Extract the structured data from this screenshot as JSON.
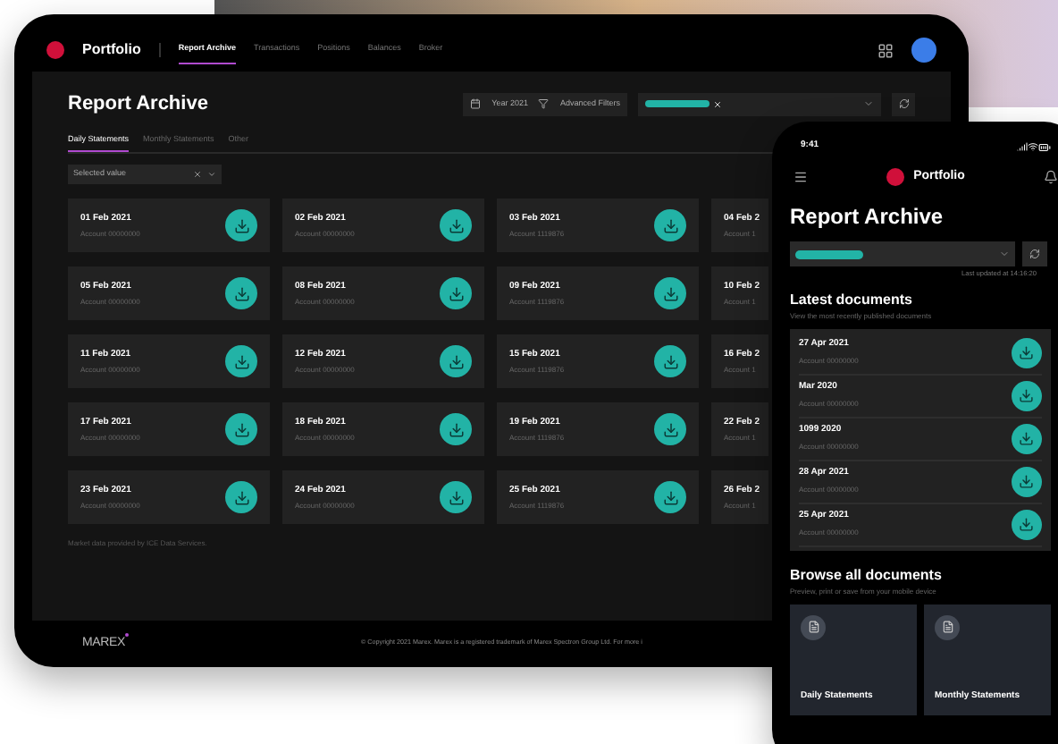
{
  "tablet": {
    "brand": "Portfolio",
    "nav": [
      {
        "label": "Report Archive",
        "selected": true
      },
      {
        "label": "Transactions",
        "selected": false
      },
      {
        "label": "Positions",
        "selected": false
      },
      {
        "label": "Balances",
        "selected": false
      },
      {
        "label": "Broker",
        "selected": false
      }
    ],
    "title": "Report Archive",
    "year_filter": "Year 2021",
    "advanced_filters": "Advanced Filters",
    "tabs": [
      {
        "label": "Daily Statements",
        "selected": true
      },
      {
        "label": "Monthly Statements",
        "selected": false
      },
      {
        "label": "Other",
        "selected": false
      }
    ],
    "select": {
      "value": "Selected value"
    },
    "cards": [
      {
        "date": "01 Feb 2021",
        "account": "Account 00000000"
      },
      {
        "date": "02 Feb 2021",
        "account": "Account 00000000"
      },
      {
        "date": "03 Feb 2021",
        "account": "Account 1119876"
      },
      {
        "date": "04 Feb 2",
        "account": "Account 1"
      },
      {
        "date": "05 Feb 2021",
        "account": "Account 00000000"
      },
      {
        "date": "08 Feb 2021",
        "account": "Account 00000000"
      },
      {
        "date": "09 Feb 2021",
        "account": "Account 1119876"
      },
      {
        "date": "10 Feb 2",
        "account": "Account 1"
      },
      {
        "date": "11 Feb 2021",
        "account": "Account 00000000"
      },
      {
        "date": "12 Feb 2021",
        "account": "Account 00000000"
      },
      {
        "date": "15 Feb 2021",
        "account": "Account 1119876"
      },
      {
        "date": "16 Feb 2",
        "account": "Account 1"
      },
      {
        "date": "17 Feb 2021",
        "account": "Account 00000000"
      },
      {
        "date": "18 Feb 2021",
        "account": "Account 00000000"
      },
      {
        "date": "19 Feb 2021",
        "account": "Account 1119876"
      },
      {
        "date": "22 Feb 2",
        "account": "Account 1"
      },
      {
        "date": "23 Feb 2021",
        "account": "Account 00000000"
      },
      {
        "date": "24 Feb 2021",
        "account": "Account 00000000"
      },
      {
        "date": "25 Feb 2021",
        "account": "Account 1119876"
      },
      {
        "date": "26 Feb 2",
        "account": "Account 1"
      }
    ],
    "note": "Market data provided by ICE Data Services.",
    "footer_logo": "MAREX",
    "copyright": "© Copyright 2021 Marex. Marex is a registered trademark of Marex Spectron Group Ltd. For more i"
  },
  "phone": {
    "time": "9:41",
    "brand": "Portfolio",
    "title": "Report Archive",
    "last_updated": "Last updated at 14:16:20",
    "latest_title": "Latest documents",
    "latest_subtitle": "View the most recently published documents",
    "documents": [
      {
        "date": "27 Apr 2021",
        "account": "Account 00000000"
      },
      {
        "date": "Mar 2020",
        "account": "Account 00000000"
      },
      {
        "date": "1099 2020",
        "account": "Account 00000000"
      },
      {
        "date": "28 Apr 2021",
        "account": "Account 00000000"
      },
      {
        "date": "25 Apr 2021",
        "account": "Account 00000000"
      }
    ],
    "browse_title": "Browse all documents",
    "browse_subtitle": "Preview, print or save from your mobile device",
    "tiles": [
      {
        "label": "Daily Statements"
      },
      {
        "label": "Monthly Statements"
      }
    ]
  }
}
